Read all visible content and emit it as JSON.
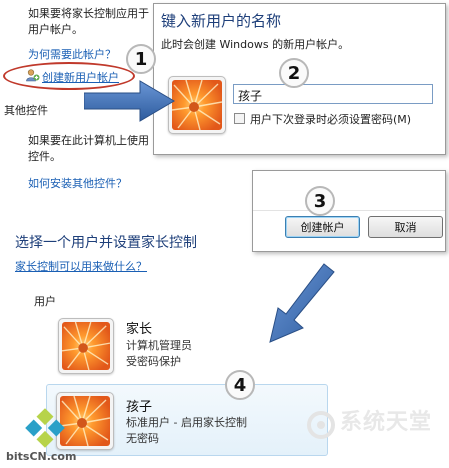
{
  "background": {
    "intro_line1": "如果要将家长控制应用于",
    "intro_line2": "用户帐户。",
    "why_link": "为何需要此帐户？",
    "create_link": "创建新用户帐户",
    "other_controls_heading": "其他控件",
    "other_line1": "如果要在此计算机上使用",
    "other_line2": "控件。",
    "install_link": "如何安装其他控件？"
  },
  "dialog_new_user": {
    "title": "键入新用户的名称",
    "subtitle": "此时会创建 Windows 的新用户帐户。",
    "name_value": "孩子",
    "checkbox_label": "用户下次登录时必须设置密码(M)"
  },
  "dialog_buttons": {
    "create_label": "创建帐户",
    "cancel_label": "取消"
  },
  "select_section": {
    "heading": "选择一个用户并设置家长控制",
    "help_link": "家长控制可以用来做什么？",
    "users_label": "用户"
  },
  "users": [
    {
      "name": "家长",
      "line1": "计算机管理员",
      "line2": "受密码保护"
    },
    {
      "name": "孩子",
      "line1": "标准用户 - 启用家长控制",
      "line2": "无密码"
    }
  ],
  "badges": [
    "1",
    "2",
    "3",
    "4"
  ],
  "watermarks": {
    "bits": "bitsCN.com",
    "xp": "系统天堂"
  },
  "colors": {
    "link": "#1a5fb4",
    "arrow": "#3f6fb6",
    "ellipse": "#c0392b"
  }
}
